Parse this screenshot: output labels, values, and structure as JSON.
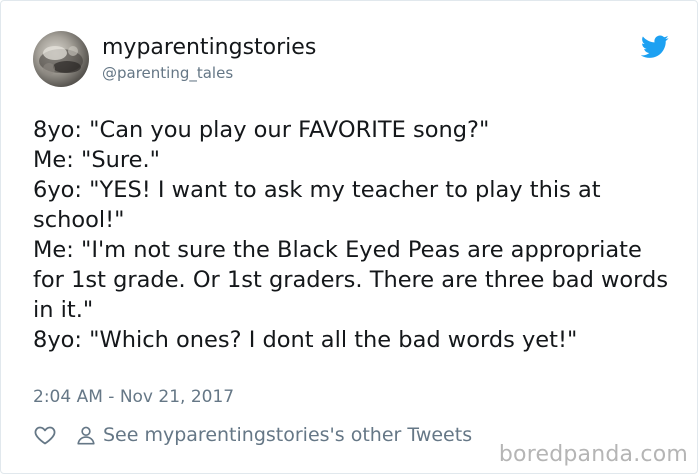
{
  "author": {
    "display_name": "myparentingstories",
    "handle": "@parenting_tales"
  },
  "icons": {
    "avatar": "avatar-photo",
    "brand": "twitter-bird-icon",
    "like": "heart-icon",
    "profile": "person-icon"
  },
  "colors": {
    "brand_blue": "#1da1f2",
    "muted_gray": "#657786",
    "text": "#14171a"
  },
  "tweet": {
    "text": "8yo: \"Can you play our FAVORITE song?\"\nMe: \"Sure.\"\n6yo: \"YES! I want to ask my teacher to play this at school!\"\nMe: \"I'm not sure the Black Eyed Peas are appropriate for 1st grade. Or 1st graders. There are three bad words in it.\"\n8yo: \"Which ones? I dont all the bad words yet!\"",
    "timestamp": "2:04 AM - Nov 21, 2017"
  },
  "actions": {
    "other_tweets_label": "See myparentingstories's other Tweets"
  },
  "watermark": {
    "text": "boredpanda.com"
  }
}
